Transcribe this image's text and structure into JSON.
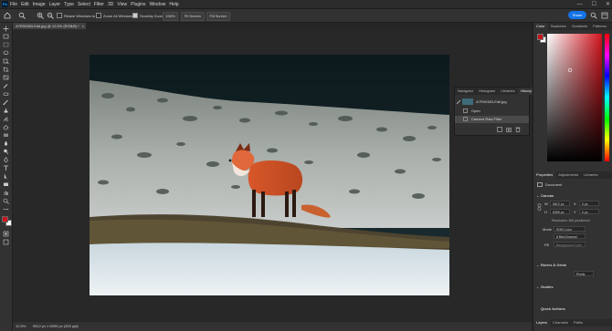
{
  "menu": {
    "app_icon": "Ps",
    "items": [
      "File",
      "Edit",
      "Image",
      "Layer",
      "Type",
      "Select",
      "Filter",
      "3D",
      "View",
      "Plugins",
      "Window",
      "Help"
    ]
  },
  "window_controls": {
    "minimize": "—",
    "maximize": "☐",
    "close": "✕"
  },
  "options_bar": {
    "resize_windows_label": "Resize Windows to Fit",
    "zoom_all_windows_label": "Zoom All Windows",
    "scrubby_zoom_label": "Scrubby Zoom",
    "zoom_100_label": "100%",
    "fit_screen_label": "Fit Screen",
    "fill_screen_label": "Fill Screen",
    "share_label": "Share"
  },
  "document": {
    "tab_label": "A7R00383-Edit.jpg @ 12.5% (RGB/8) *",
    "close_glyph": "×"
  },
  "status_bar": {
    "zoom": "12.5%",
    "dimensions": "9612 px x 6399 px (300 ppi)"
  },
  "history_panel": {
    "tabs": [
      "Navigator",
      "Histogram",
      "Libraries",
      "History"
    ],
    "active_tab": "History",
    "snapshot_label": "A7R00383-Edit.jpg",
    "states": [
      "Open",
      "Camera Raw Filter"
    ]
  },
  "color_panel": {
    "tabs": [
      "Color",
      "Swatches",
      "Gradients",
      "Patterns"
    ],
    "active_tab": "Color",
    "hue_color": "#d3131c"
  },
  "properties_panel": {
    "tabs": [
      "Properties",
      "Adjustments",
      "Libraries"
    ],
    "active_tab": "Properties",
    "document_label": "Document",
    "canvas_section": "Canvas",
    "width_label": "W",
    "width_value": "9612 px",
    "height_label": "H",
    "height_value": "6399 px",
    "x_label": "X",
    "x_value": "0 px",
    "y_label": "Y",
    "y_value": "0 px",
    "resolution_text": "Resolution: 300 pixels/inch",
    "mode_label": "Mode",
    "mode_value": "RGB Color",
    "depth_value": "8 Bits/Channel",
    "fill_label": "Fill",
    "fill_value": "Background Color",
    "rulers_section": "Rulers & Grids",
    "ruler_unit": "Pixels",
    "guides_section": "Guides",
    "quick_actions_section": "Quick Actions"
  },
  "layers_panel": {
    "tabs": [
      "Layers",
      "Channels",
      "Paths"
    ],
    "active_tab": "Layers"
  },
  "swatch_colors": {
    "foreground": "#c8141e",
    "background": "#ffffff"
  },
  "toolbar": {
    "tool_icons": [
      "move-icon",
      "artboard-icon",
      "marquee-icon",
      "lasso-icon",
      "object-select-icon",
      "crop-icon",
      "frame-icon",
      "eyedropper-icon",
      "healing-brush-icon",
      "brush-icon",
      "clone-stamp-icon",
      "history-brush-icon",
      "eraser-icon",
      "gradient-icon",
      "blur-icon",
      "dodge-icon",
      "pen-icon",
      "type-icon",
      "path-select-icon",
      "rectangle-icon",
      "hand-icon",
      "zoom-icon",
      "edit-toolbar-icon"
    ]
  }
}
